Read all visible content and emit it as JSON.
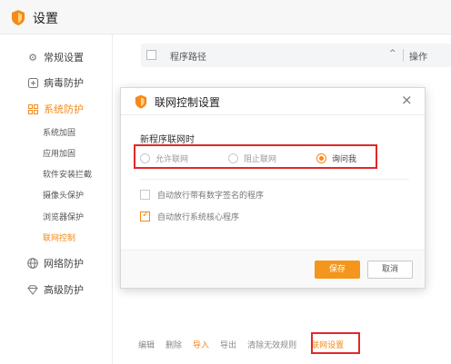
{
  "app": {
    "title": "设置",
    "accent": "#f48a1c",
    "highlight_box_color": "#e02828"
  },
  "sidebar": {
    "items": [
      {
        "label": "常规设置",
        "icon": "gear-icon"
      },
      {
        "label": "病毒防护",
        "icon": "plus-square-icon"
      },
      {
        "label": "系统防护",
        "icon": "system-grid-icon",
        "active": true
      },
      {
        "label": "网络防护",
        "icon": "globe-icon"
      },
      {
        "label": "高级防护",
        "icon": "diamond-icon"
      }
    ],
    "sub_items": [
      {
        "label": "系统加固"
      },
      {
        "label": "应用加固"
      },
      {
        "label": "软件安装拦截"
      },
      {
        "label": "摄像头保护"
      },
      {
        "label": "浏览器保护"
      },
      {
        "label": "联网控制",
        "active": true
      }
    ]
  },
  "table": {
    "col_path": "程序路径",
    "sort_icon": "^",
    "col_op": "操作"
  },
  "bottom_actions": {
    "edit": "编辑",
    "delete": "删除",
    "import": "导入",
    "export": "导出",
    "clear_invalid": "清除无效规则",
    "network_settings": "联网设置"
  },
  "dialog": {
    "title": "联网控制设置",
    "close": "×",
    "section_label": "新程序联网时",
    "radios": [
      {
        "label": "允许联网",
        "selected": false
      },
      {
        "label": "阻止联网",
        "selected": false
      },
      {
        "label": "询问我",
        "selected": true
      }
    ],
    "checks": [
      {
        "label": "自动放行带有数字签名的程序",
        "checked": false
      },
      {
        "label": "自动放行系统核心程序",
        "checked": true
      }
    ],
    "save": "保存",
    "cancel": "取消"
  }
}
